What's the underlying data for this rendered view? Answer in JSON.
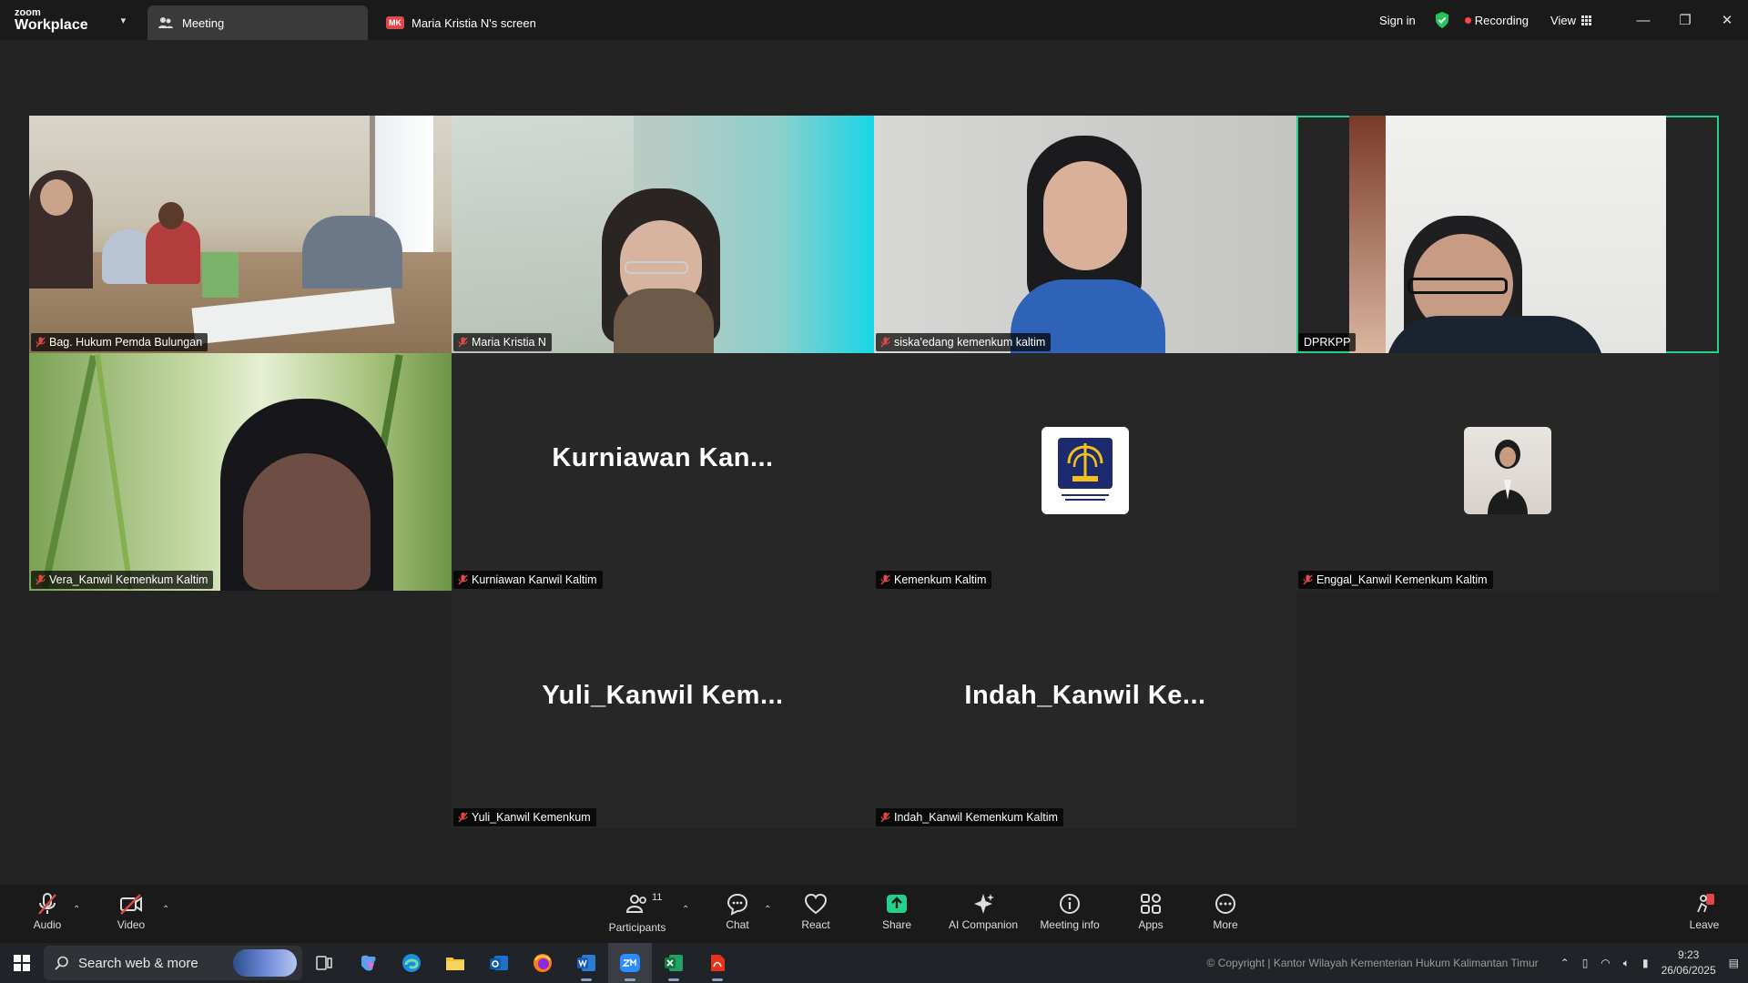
{
  "titlebar": {
    "brand_small": "zoom",
    "brand_large": "Workplace",
    "tabs": [
      {
        "label": "Meeting"
      },
      {
        "label": "Maria Kristia N's screen",
        "badge": "MK"
      }
    ],
    "sign_in": "Sign in",
    "recording": "Recording",
    "view": "View"
  },
  "participants": [
    {
      "name": "Bag. Hukum Pemda Bulungan",
      "display": "video"
    },
    {
      "name": "Maria Kristia N",
      "display": "video"
    },
    {
      "name": "siska'edang kemenkum kaltim",
      "display": "video"
    },
    {
      "name": "DPRKPP",
      "display": "video",
      "active_speaker": true
    },
    {
      "name": "Vera_Kanwil Kemenkum Kaltim",
      "display": "video"
    },
    {
      "name": "Kurniawan Kanwil Kaltim",
      "display": "name",
      "big_name": "Kurniawan  Kan..."
    },
    {
      "name": "Kemenkum Kaltim",
      "display": "avatar",
      "avatar_text": "PENGAYOMAN"
    },
    {
      "name": "Enggal_Kanwil Kemenkum Kaltim",
      "display": "avatar"
    },
    {
      "name": "Yuli_Kanwil Kemenkum",
      "display": "name",
      "big_name": "Yuli_Kanwil  Kem..."
    },
    {
      "name": "Indah_Kanwil Kemenkum Kaltim",
      "display": "name",
      "big_name": "Indah_Kanwil  Ke..."
    }
  ],
  "toolbar": {
    "audio": "Audio",
    "video": "Video",
    "participants": "Participants",
    "participants_count": "11",
    "chat": "Chat",
    "react": "React",
    "share": "Share",
    "ai_companion": "AI Companion",
    "meeting_info": "Meeting info",
    "apps": "Apps",
    "more": "More",
    "leave": "Leave"
  },
  "taskbar": {
    "search_placeholder": "Search web & more",
    "copyright": "© Copyright | Kantor Wilayah Kementerian Hukum Kalimantan Timur",
    "time": "9:23",
    "date": "26/06/2025"
  },
  "colors": {
    "active_speaker": "#23d18b",
    "recording": "#ff4545",
    "share": "#23d18b",
    "muted": "#e04848"
  }
}
